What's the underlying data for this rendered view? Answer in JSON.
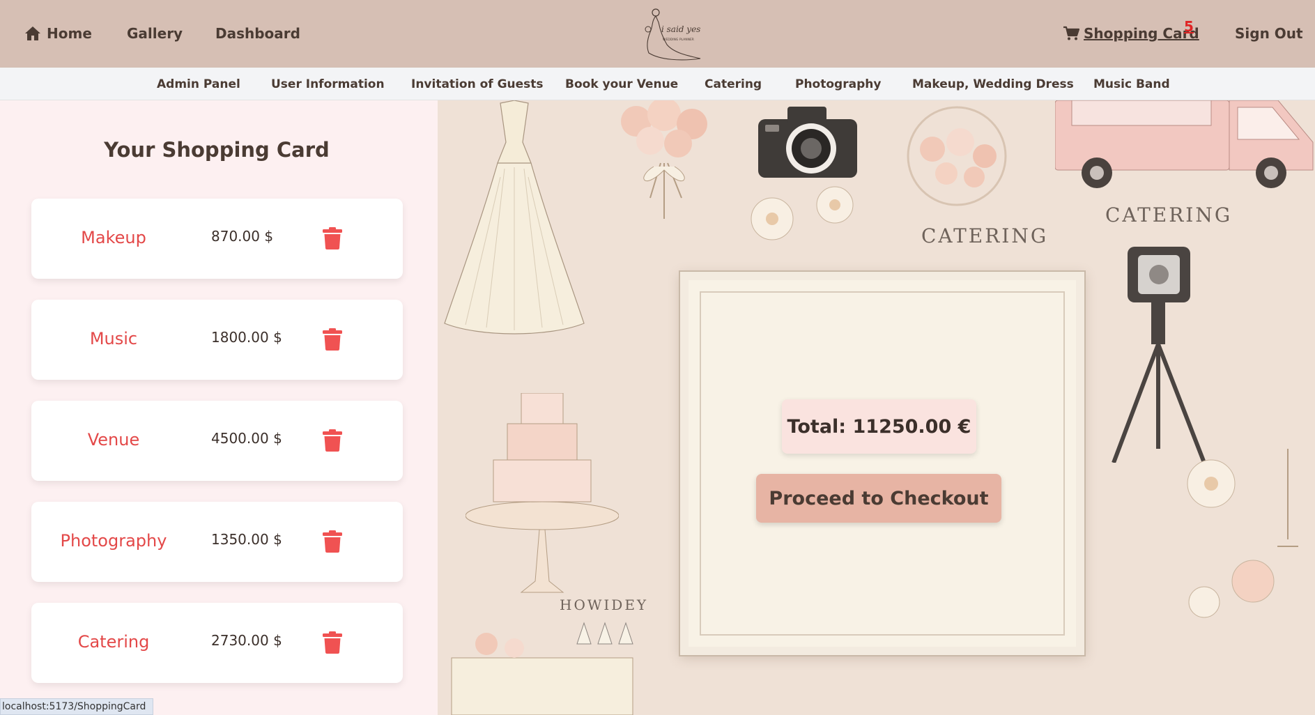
{
  "topnav": {
    "home_label": "Home",
    "gallery_label": "Gallery",
    "dashboard_label": "Dashboard",
    "cart_label": "Shopping Card",
    "cart_count": "5",
    "signout_label": "Sign Out",
    "logo_text": "i said yes",
    "logo_subtext": "WEDDING PLANNER"
  },
  "subnav": {
    "items": [
      "Admin Panel",
      "User Information",
      "Invitation of Guests",
      "Book your Venue",
      "Catering",
      "Photography",
      "Makeup, Wedding Dress",
      "Music Band"
    ]
  },
  "cart": {
    "title": "Your Shopping Card",
    "items": [
      {
        "name": "Makeup",
        "price": "870.00 $"
      },
      {
        "name": "Music",
        "price": "1800.00 $"
      },
      {
        "name": "Venue",
        "price": "4500.00 $"
      },
      {
        "name": "Photography",
        "price": "1350.00 $"
      },
      {
        "name": "Catering",
        "price": "2730.00 $"
      }
    ],
    "total": "Total: 11250.00 €",
    "checkout_label": "Proceed to Checkout"
  },
  "background": {
    "catering_label": "CATERING",
    "catering_label_2": "CATERING",
    "cake_label": "HOWIDEY"
  },
  "status_url": "localhost:5173/ShoppingCard",
  "colors": {
    "topbar": "#d6bfb4",
    "subnav": "#f3f4f6",
    "item_name": "#e34848",
    "trash": "#f05252",
    "badge": "#e02424",
    "checkout": "#e7b4a4",
    "total_box": "#fae3df"
  },
  "icons": [
    "home-icon",
    "shopping-cart-icon",
    "trash-icon"
  ]
}
